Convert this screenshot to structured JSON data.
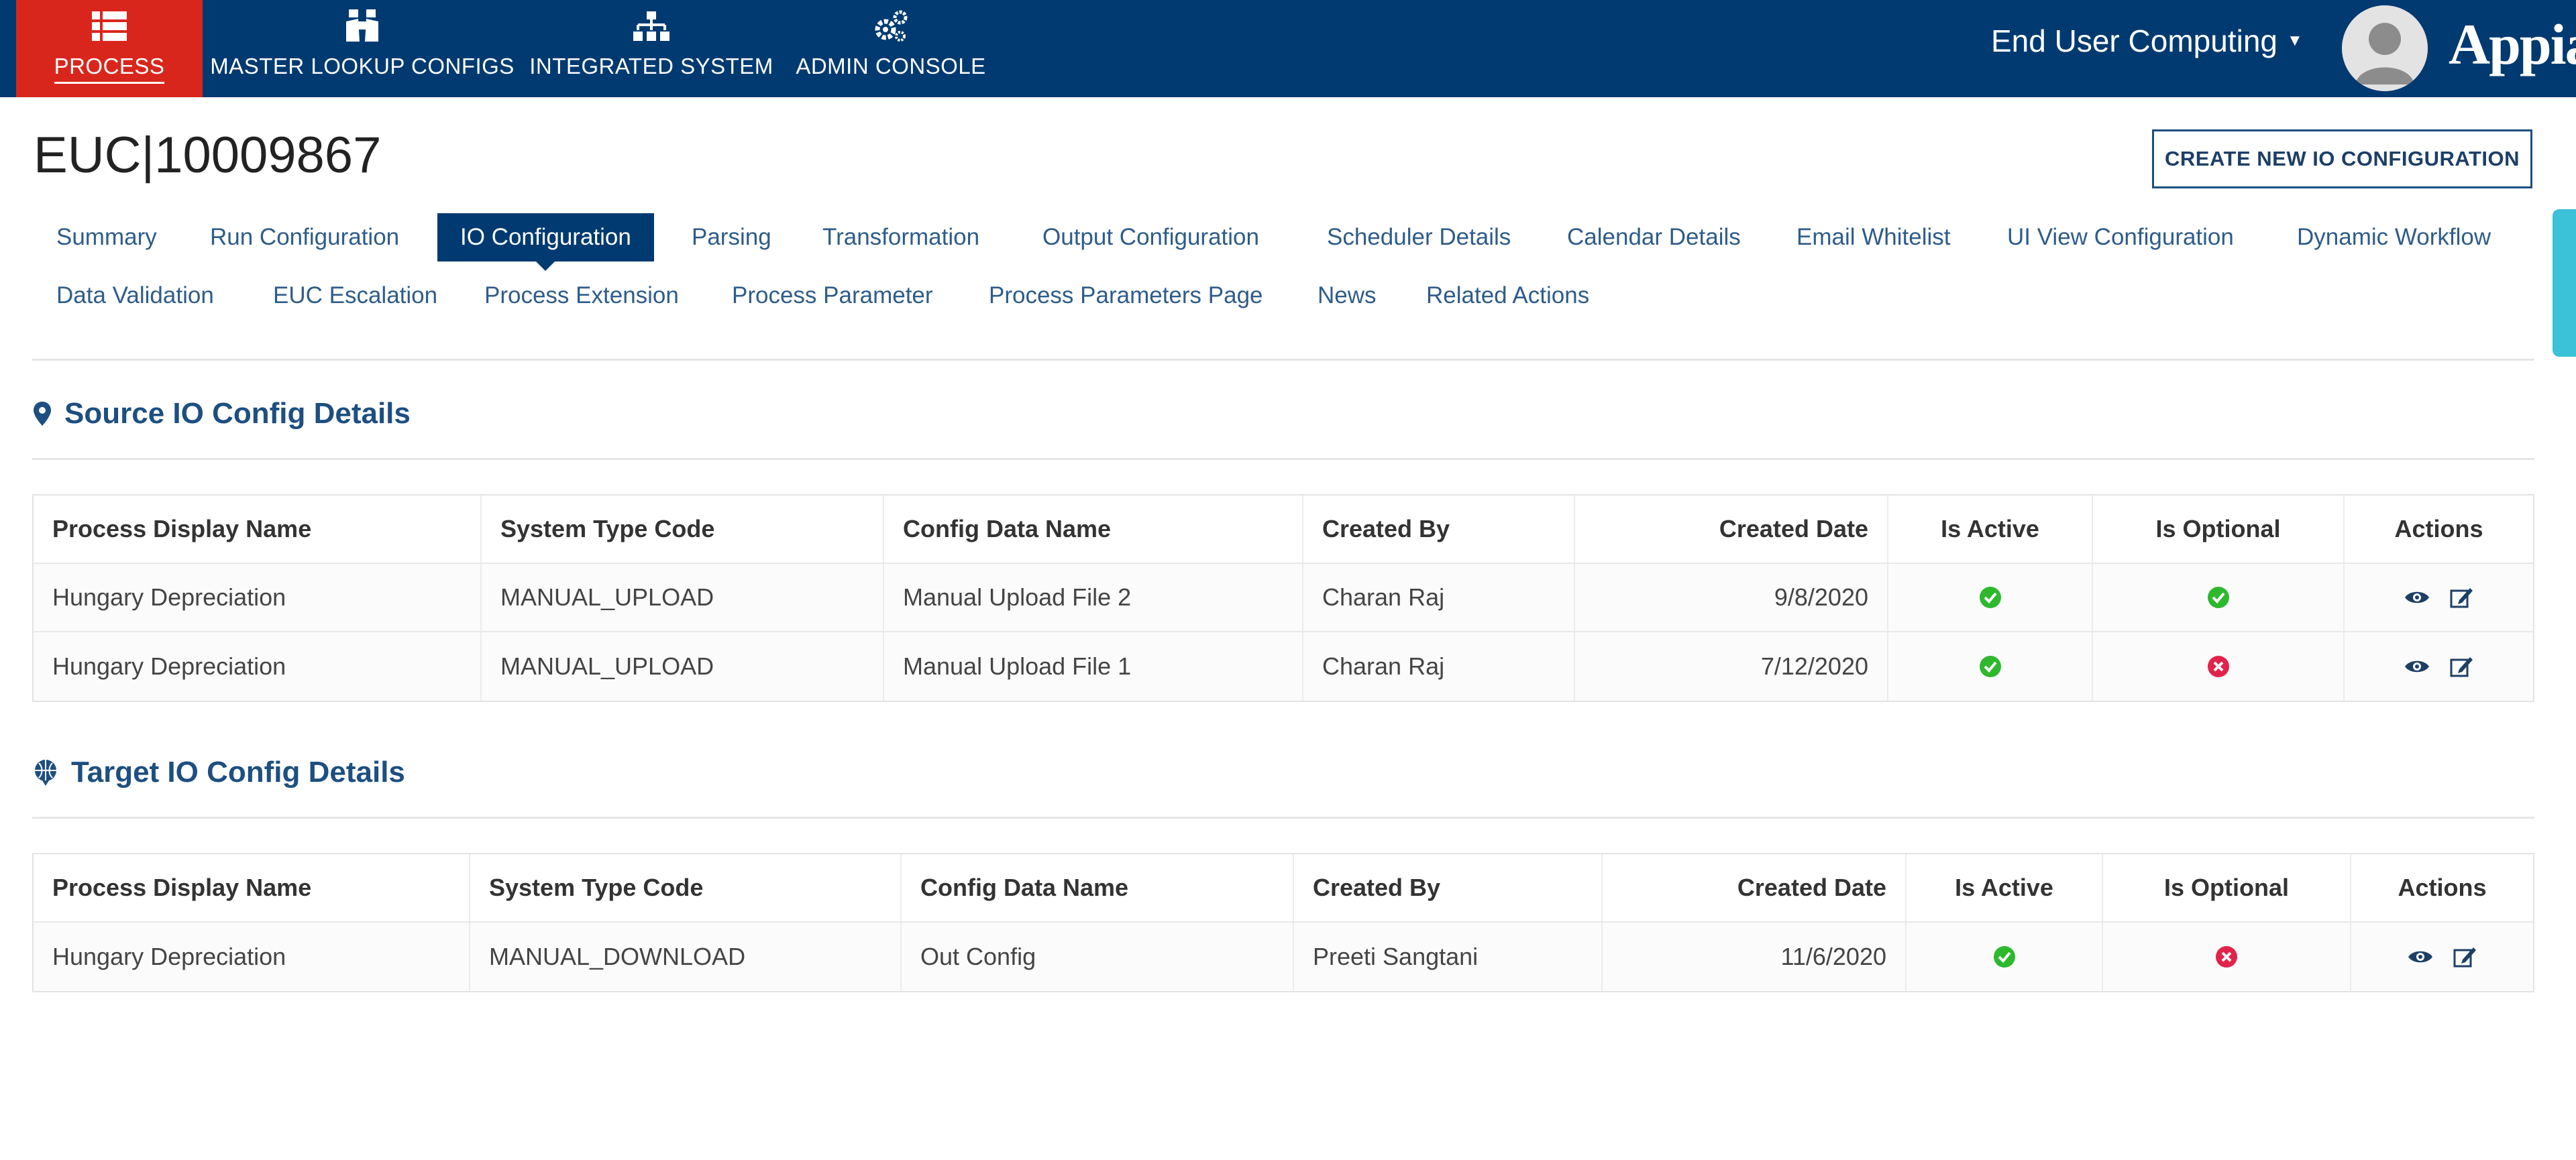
{
  "nav": {
    "items": [
      {
        "label": "PROCESS",
        "icon": "list-icon"
      },
      {
        "label": "MASTER LOOKUP CONFIGS",
        "icon": "binoculars-icon"
      },
      {
        "label": "INTEGRATED SYSTEM",
        "icon": "hierarchy-icon"
      },
      {
        "label": "ADMIN CONSOLE",
        "icon": "gears-icon"
      }
    ],
    "user_menu_label": "End User Computing",
    "brand": "Appian"
  },
  "page": {
    "title": "EUC|10009867",
    "create_button_label": "CREATE NEW IO CONFIGURATION"
  },
  "tabs": [
    "Summary",
    "Run Configuration",
    "IO Configuration",
    "Parsing",
    "Transformation",
    "Output Configuration",
    "Scheduler Details",
    "Calendar Details",
    "Email Whitelist",
    "UI View Configuration",
    "Dynamic Workflow",
    "Data Validation",
    "EUC Escalation",
    "Process Extension",
    "Process Parameter",
    "Process Parameters Page",
    "News",
    "Related Actions"
  ],
  "active_tab": "IO Configuration",
  "source": {
    "title": "Source IO Config Details",
    "columns": [
      "Process Display Name",
      "System Type Code",
      "Config Data Name",
      "Created By",
      "Created Date",
      "Is Active",
      "Is Optional",
      "Actions"
    ],
    "rows": [
      {
        "process": "Hungary Depreciation",
        "system": "MANUAL_UPLOAD",
        "config": "Manual Upload File 2",
        "created_by": "Charan Raj",
        "created_date": "9/8/2020",
        "is_active": true,
        "is_optional": true
      },
      {
        "process": "Hungary Depreciation",
        "system": "MANUAL_UPLOAD",
        "config": "Manual Upload File 1",
        "created_by": "Charan Raj",
        "created_date": "7/12/2020",
        "is_active": true,
        "is_optional": false
      }
    ]
  },
  "target": {
    "title": "Target IO Config Details",
    "columns": [
      "Process Display Name",
      "System Type Code",
      "Config Data Name",
      "Created By",
      "Created Date",
      "Is Active",
      "Is Optional",
      "Actions"
    ],
    "rows": [
      {
        "process": "Hungary Depreciation",
        "system": "MANUAL_DOWNLOAD",
        "config": "Out Config",
        "created_by": "Preeti Sangtani",
        "created_date": "11/6/2020",
        "is_active": true,
        "is_optional": false
      }
    ]
  },
  "colors": {
    "nav_bg": "#003a70",
    "nav_active": "#d9261c",
    "link": "#2e5c8a",
    "check_green": "#2eb82e",
    "cross_red": "#e0244b"
  }
}
